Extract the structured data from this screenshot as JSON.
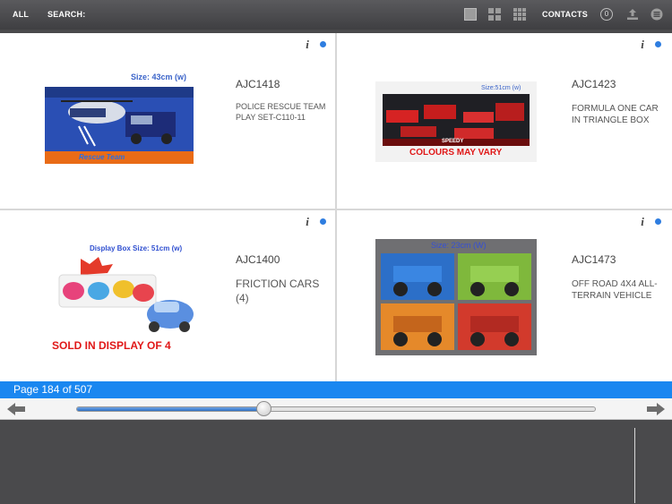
{
  "topbar": {
    "all_label": "ALL",
    "search_label": "SEARCH:",
    "contacts_label": "CONTACTS",
    "cart_count": "0",
    "icons": [
      "single-view-icon",
      "grid-4-icon",
      "grid-9-icon",
      "cart-badge-icon",
      "share-icon",
      "menu-icon"
    ]
  },
  "products": [
    {
      "code": "AJC1418",
      "description": "POLICE RESCUE TEAM PLAY SET-C110-11",
      "size_text": "Size: 43cm (w)",
      "banner_text": "",
      "image_caption": "Rescue Team"
    },
    {
      "code": "AJC1423",
      "description": "FORMULA ONE CAR IN TRIANGLE BOX",
      "size_text": "Size:51cm (w)",
      "banner_text": "COLOURS MAY VARY",
      "image_caption": "SPEEDY"
    },
    {
      "code": "AJC1400",
      "description": "FRICTION CARS (4)",
      "size_text": "Display Box Size: 51cm (w)",
      "banner_text": "SOLD IN DISPLAY OF 4",
      "image_caption": ""
    },
    {
      "code": "AJC1473",
      "description": "OFF ROAD 4X4 ALL-TERRAIN VEHICLE",
      "size_text": "Size: 23cm (W)",
      "banner_text": "",
      "image_caption": ""
    }
  ],
  "info_glyph": "i",
  "pager": {
    "label": "Page 184 of 507",
    "current": 184,
    "total": 507
  },
  "colors": {
    "accent": "#1a87f0",
    "dot": "#2e7de0",
    "topbar": "#4a4a4c"
  }
}
